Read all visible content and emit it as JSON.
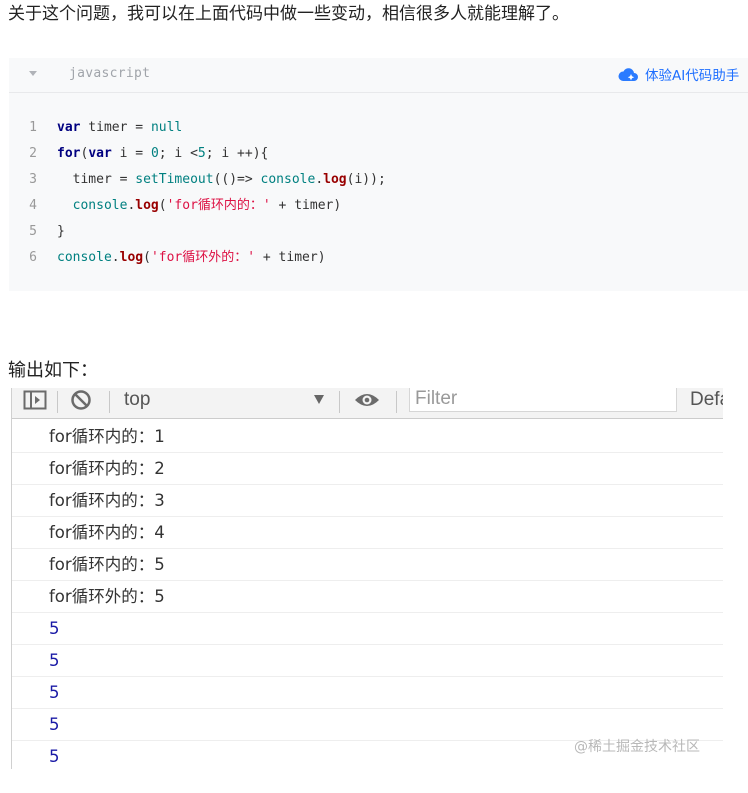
{
  "intro_text": "关于这个问题，我可以在上面代码中做一些变动，相信很多人就能理解了。",
  "code_block": {
    "language": "javascript",
    "ai_helper_label": "体验AI代码助手",
    "lines": [
      {
        "n": "1",
        "tokens": [
          [
            "kw",
            "var"
          ],
          [
            "p",
            " timer = "
          ],
          [
            "nul",
            "null"
          ]
        ]
      },
      {
        "n": "2",
        "tokens": [
          [
            "kw",
            "for"
          ],
          [
            "p",
            "("
          ],
          [
            "kw",
            "var"
          ],
          [
            "p",
            " i = "
          ],
          [
            "num",
            "0"
          ],
          [
            "p",
            "; i <"
          ],
          [
            "num",
            "5"
          ],
          [
            "p",
            "; i ++){"
          ]
        ]
      },
      {
        "n": "3",
        "tokens": [
          [
            "p",
            "  timer = "
          ],
          [
            "fn",
            "setTimeout"
          ],
          [
            "p",
            "(()=> "
          ],
          [
            "fn",
            "console"
          ],
          [
            "p",
            "."
          ],
          [
            "meth",
            "log"
          ],
          [
            "p",
            "(i));"
          ]
        ]
      },
      {
        "n": "4",
        "tokens": [
          [
            "p",
            "  "
          ],
          [
            "fn",
            "console"
          ],
          [
            "p",
            "."
          ],
          [
            "meth",
            "log"
          ],
          [
            "p",
            "("
          ],
          [
            "str",
            "'for循环内的：'"
          ],
          [
            "p",
            " + timer)"
          ]
        ]
      },
      {
        "n": "5",
        "tokens": [
          [
            "p",
            "}"
          ]
        ]
      },
      {
        "n": "6",
        "tokens": [
          [
            "fn",
            "console"
          ],
          [
            "p",
            "."
          ],
          [
            "meth",
            "log"
          ],
          [
            "p",
            "("
          ],
          [
            "str",
            "'for循环外的：'"
          ],
          [
            "p",
            " + timer)"
          ]
        ]
      }
    ]
  },
  "output_label": "输出如下：",
  "console": {
    "context": "top",
    "filter_placeholder": "Filter",
    "levels_label": "Defa",
    "rows": [
      {
        "text": "for循环内的：1",
        "numeric": false
      },
      {
        "text": "for循环内的：2",
        "numeric": false
      },
      {
        "text": "for循环内的：3",
        "numeric": false
      },
      {
        "text": "for循环内的：4",
        "numeric": false
      },
      {
        "text": "for循环内的：5",
        "numeric": false
      },
      {
        "text": "for循环外的：5",
        "numeric": false
      },
      {
        "text": "5",
        "numeric": true
      },
      {
        "text": "5",
        "numeric": true
      },
      {
        "text": "5",
        "numeric": true
      },
      {
        "text": "5",
        "numeric": true
      },
      {
        "text": "5",
        "numeric": true
      }
    ]
  },
  "watermark": "@稀土掘金技术社区",
  "icons": {
    "collapse": "chevron-down-icon",
    "ai": "cloud-icon",
    "sidebar": "sidebar-toggle-icon",
    "clear": "clear-console-icon",
    "eye": "eye-icon"
  },
  "colors": {
    "accent": "#1e6fff",
    "string": "#dd1144",
    "keyword": "#000080",
    "console_number": "#1a1aa6"
  }
}
